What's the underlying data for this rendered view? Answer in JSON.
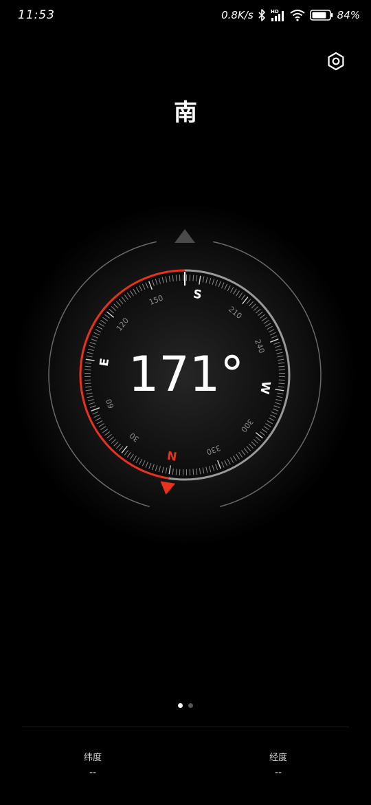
{
  "status_bar": {
    "time": "11:53",
    "network_speed": "0.8K/s",
    "battery_percent": "84%",
    "icons": [
      "bluetooth-icon",
      "hd-signal-icon",
      "wifi-icon",
      "battery-icon"
    ]
  },
  "header": {
    "settings_icon": "settings-hexagon-icon",
    "direction": "南"
  },
  "compass": {
    "heading_text": "171°",
    "heading_deg": 171,
    "cardinals": {
      "n": "N",
      "e": "E",
      "s": "S",
      "w": "W"
    },
    "degree_labels": [
      "30",
      "60",
      "120",
      "150",
      "210",
      "240",
      "300",
      "330"
    ],
    "accent_color": "#e8321c",
    "ring_color": "#9a9a9a"
  },
  "pager": {
    "pages": 2,
    "active_index": 0
  },
  "coordinates": {
    "latitude_label": "纬度",
    "latitude_value": "--",
    "longitude_label": "经度",
    "longitude_value": "--"
  }
}
